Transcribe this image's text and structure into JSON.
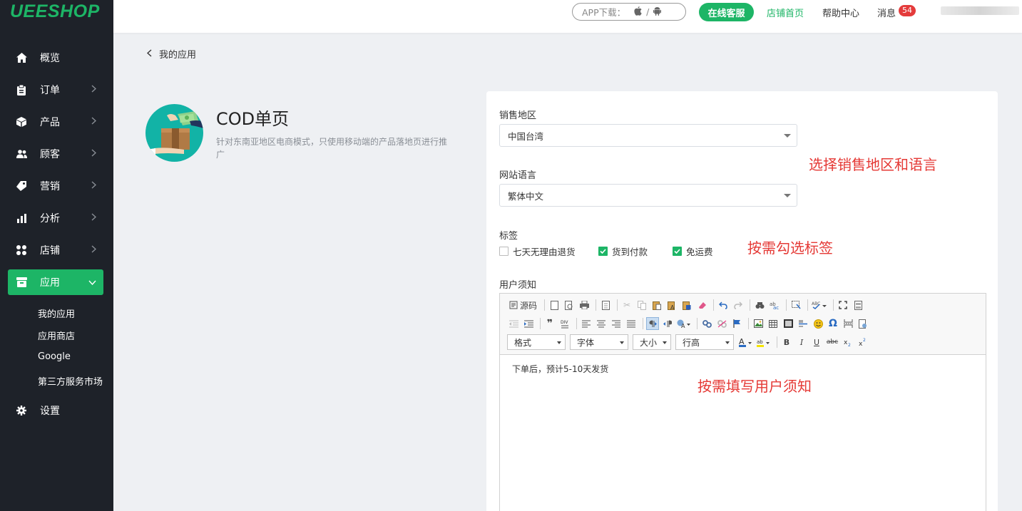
{
  "brand": {
    "logo": "UEESHOP"
  },
  "sidebar": {
    "items": [
      {
        "label": "概览",
        "icon": "home-icon"
      },
      {
        "label": "订单",
        "icon": "clipboard-icon"
      },
      {
        "label": "产品",
        "icon": "box-icon"
      },
      {
        "label": "顾客",
        "icon": "users-icon"
      },
      {
        "label": "营销",
        "icon": "tag-icon"
      },
      {
        "label": "分析",
        "icon": "bar-chart-icon"
      },
      {
        "label": "店铺",
        "icon": "grid-icon"
      },
      {
        "label": "应用",
        "icon": "app-store-icon",
        "active": true
      },
      {
        "label": "设置",
        "icon": "gear-icon"
      }
    ],
    "sub_items": [
      "我的应用",
      "应用商店",
      "Google",
      "第三方服务市场"
    ]
  },
  "topbar": {
    "app_download": "APP下载：",
    "sep": "/",
    "online_service": "在线客服",
    "store_home": "店铺首页",
    "help_center": "帮助中心",
    "messages": "消息",
    "message_count": "54"
  },
  "breadcrumb": {
    "back": "我的应用"
  },
  "app": {
    "title": "COD单页",
    "description": "针对东南亚地区电商模式，只使用移动端的产品落地页进行推广"
  },
  "form": {
    "region_label": "销售地区",
    "region_value": "中国台湾",
    "language_label": "网站语言",
    "language_value": "繁体中文",
    "tags_label": "标签",
    "tags": [
      {
        "label": "七天无理由退货",
        "checked": false
      },
      {
        "label": "货到付款",
        "checked": true
      },
      {
        "label": "免运费",
        "checked": true
      }
    ],
    "notice_label": "用户须知",
    "notice_text": "下单后，预计5-10天发货"
  },
  "editor": {
    "source_label": "源码",
    "combos": [
      "格式",
      "字体",
      "大小",
      "行高"
    ]
  },
  "annotations": {
    "region_lang": "选择销售地区和语言",
    "tags": "按需勾选标签",
    "notice": "按需填写用户须知"
  },
  "colors": {
    "brand_green": "#1db566",
    "sidebar_bg": "#1e2229",
    "annotation_red": "#e53935",
    "badge_red": "#e43b3b"
  }
}
